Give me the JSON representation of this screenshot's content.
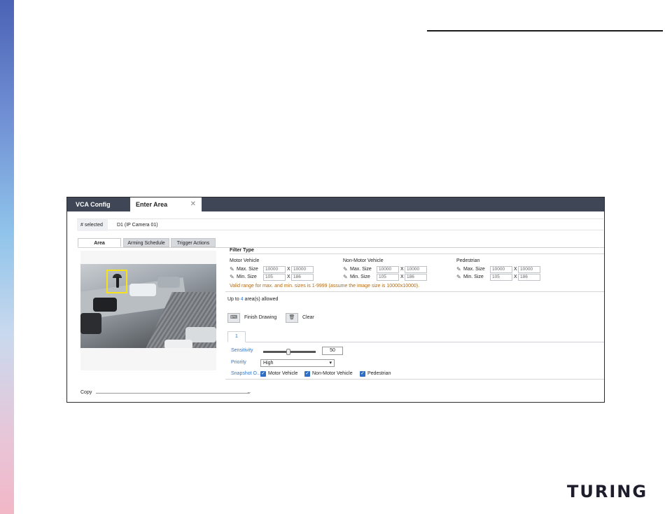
{
  "brand": "TURING",
  "tabs": {
    "vca_config": "VCA Config",
    "enter_area": "Enter Area",
    "close": "✕"
  },
  "selection": {
    "label": "# selected",
    "value": "D1 (IP Camera 01)"
  },
  "subtabs": {
    "area": "Area",
    "arming_schedule": "Arming Schedule",
    "trigger_actions": "Trigger Actions"
  },
  "filter": {
    "title": "Filter Type",
    "max_label": "Max. Size",
    "min_label": "Min. Size",
    "x": "X",
    "columns": [
      {
        "title": "Motor Vehicle",
        "max_w": "10000",
        "max_h": "10000",
        "min_w": "105",
        "min_h": "186"
      },
      {
        "title": "Non-Motor Vehicle",
        "max_w": "10000",
        "max_h": "10000",
        "min_w": "105",
        "min_h": "186"
      },
      {
        "title": "Pedestrian",
        "max_w": "10000",
        "max_h": "10000",
        "min_w": "105",
        "min_h": "186"
      }
    ],
    "valid_range": "Valid range for max. and min. sizes is 1-9999 (assume the image size is 10000x10000)."
  },
  "areas": {
    "prefix": "Up to",
    "count": "4",
    "suffix": "area(s) allowed"
  },
  "buttons": {
    "finish": "Finish Drawing",
    "clear": "Clear"
  },
  "area_tab": "1",
  "sensitivity": {
    "label": "Sensitivity",
    "value": "50",
    "level": 0.5
  },
  "priority": {
    "label": "Priority",
    "value": "High"
  },
  "snapshot": {
    "label": "Snapshot O...",
    "options": [
      "Motor Vehicle",
      "Non-Motor Vehicle",
      "Pedestrian"
    ]
  },
  "copy": "Copy",
  "colors": {
    "tabbar": "#3f4756",
    "accent": "#2d77d0",
    "warning": "#b36a12",
    "selection_box": "#f5e21b"
  }
}
